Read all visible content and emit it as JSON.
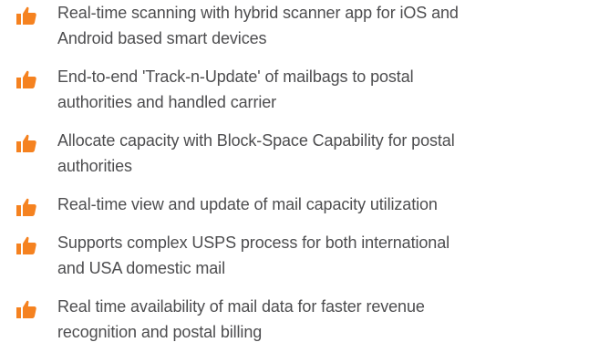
{
  "features": [
    {
      "icon": "thumbs-up-icon",
      "lines": [
        "Real-time scanning with hybrid scanner app for iOS and",
        "Android based smart devices"
      ]
    },
    {
      "icon": "thumbs-up-icon",
      "lines": [
        "End-to-end 'Track-n-Update' of mailbags to postal",
        "authorities and handled carrier"
      ]
    },
    {
      "icon": "thumbs-up-icon",
      "lines": [
        "Allocate capacity with Block-Space Capability for postal",
        "authorities"
      ]
    },
    {
      "icon": "thumbs-up-icon",
      "lines": [
        "Real-time view and update of mail capacity utilization"
      ]
    },
    {
      "icon": "thumbs-up-icon",
      "lines": [
        "Supports complex USPS process for both international",
        "and USA domestic mail"
      ]
    },
    {
      "icon": "thumbs-up-icon",
      "lines": [
        "Real time availability of mail data for faster revenue",
        "recognition and  postal billing"
      ]
    }
  ],
  "colors": {
    "icon": "#f58220",
    "text": "#4d4d4f"
  }
}
